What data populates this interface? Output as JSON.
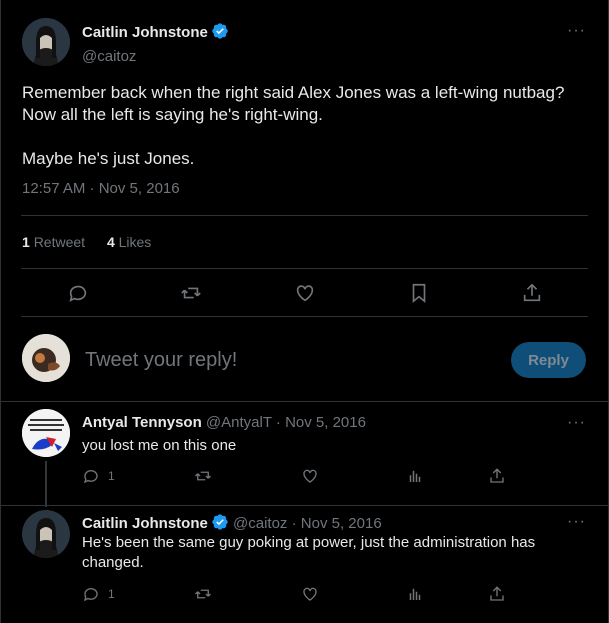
{
  "main_tweet": {
    "author_name": "Caitlin Johnstone",
    "author_handle": "@caitoz",
    "text_line1": "Remember back when the right said Alex Jones was a left-wing nutbag? Now all the left is saying he's right-wing.",
    "text_line2": "Maybe he's just Jones.",
    "timestamp": "12:57 AM · Nov 5, 2016",
    "retweet_count": "1",
    "retweet_label": "Retweet",
    "like_count": "4",
    "like_label": "Likes",
    "more": "···"
  },
  "reply_box": {
    "placeholder": "Tweet your reply!",
    "button_label": "Reply"
  },
  "replies": [
    {
      "author_name": "Antyal Tennyson",
      "author_handle": "@AntyalT",
      "date": "· Nov 5, 2016",
      "text": "you lost me on this one",
      "reply_count": "1",
      "more": "···"
    },
    {
      "author_name": "Caitlin Johnstone",
      "author_handle": "@caitoz",
      "date": "· Nov 5, 2016",
      "text": "He's been the same guy poking at power, just the administration has changed.",
      "reply_count": "1",
      "more": "···"
    }
  ],
  "colors": {
    "background": "#000000",
    "text": "#e7e9ea",
    "secondary": "#71767b",
    "verified": "#1d9bf0",
    "reply_button": "#0f4e78"
  },
  "icons": [
    "reply-icon",
    "retweet-icon",
    "like-icon",
    "bookmark-icon",
    "share-icon",
    "views-icon",
    "verified-icon",
    "more-icon"
  ]
}
